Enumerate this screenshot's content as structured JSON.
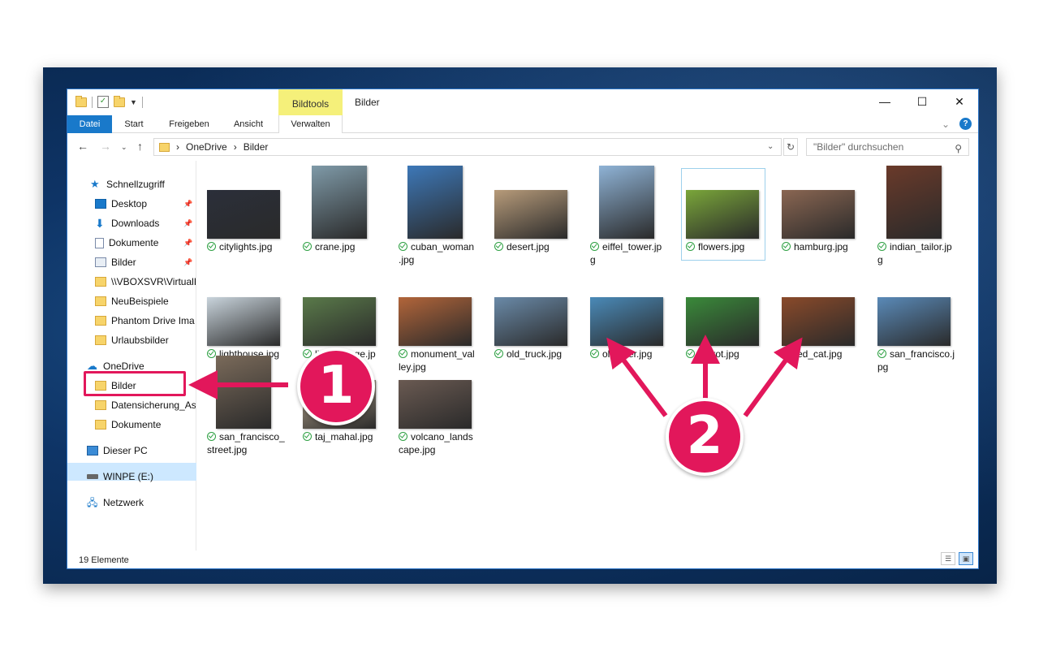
{
  "window": {
    "title": "Bilder",
    "context_tab": "Bildtools",
    "buttons": {
      "minimize": "—",
      "maximize": "☐",
      "close": "✕"
    }
  },
  "ribbon": {
    "tabs": [
      "Datei",
      "Start",
      "Freigeben",
      "Ansicht",
      "Verwalten"
    ]
  },
  "address": {
    "crumbs": [
      "OneDrive",
      "Bilder"
    ],
    "search_placeholder": "\"Bilder\" durchsuchen"
  },
  "nav": {
    "quick_access": "Schnellzugriff",
    "quick_items": [
      "Desktop",
      "Downloads",
      "Dokumente",
      "Bilder",
      "\\\\VBOXSVR\\VirtualB",
      "NeuBeispiele",
      "Phantom Drive Ima",
      "Urlaubsbilder"
    ],
    "onedrive": "OneDrive",
    "onedrive_items": [
      "Bilder",
      "Datensicherung_Ash",
      "Dokumente"
    ],
    "this_pc": "Dieser PC",
    "drive": "WINPE (E:)",
    "network": "Netzwerk"
  },
  "files": [
    {
      "name": "citylights.jpg",
      "color": "#2b2f3a"
    },
    {
      "name": "crane.jpg",
      "color": "#7f9aa8"
    },
    {
      "name": "cuban_woman.jpg",
      "color": "#3d78b8"
    },
    {
      "name": "desert.jpg",
      "color": "#b79b7a"
    },
    {
      "name": "eiffel_tower.jpg",
      "color": "#8fb3d6"
    },
    {
      "name": "flowers.jpg",
      "color": "#7aa63a"
    },
    {
      "name": "hamburg.jpg",
      "color": "#8a6652"
    },
    {
      "name": "indian_tailor.jpg",
      "color": "#6a3a2a"
    },
    {
      "name": "lighthouse.jpg",
      "color": "#c9d4dc"
    },
    {
      "name": "little_village.jpg",
      "color": "#5a7a4a"
    },
    {
      "name": "monument_valley.jpg",
      "color": "#b2653a"
    },
    {
      "name": "old_truck.jpg",
      "color": "#6a8aa8"
    },
    {
      "name": "oldtimer.jpg",
      "color": "#4a8ab8"
    },
    {
      "name": "parrot.jpg",
      "color": "#3a8a3a"
    },
    {
      "name": "red_cat.jpg",
      "color": "#8a4a2a"
    },
    {
      "name": "san_francisco.jpg",
      "color": "#5a8ab8"
    },
    {
      "name": "san_francisco_street.jpg",
      "color": "#7a6a5a"
    },
    {
      "name": "taj_mahal.jpg",
      "color": "#b8a890"
    },
    {
      "name": "volcano_landscape.jpg",
      "color": "#6a5a52"
    }
  ],
  "labels": [
    [
      "citylights.jpg"
    ],
    [
      "crane.jpg"
    ],
    [
      "cuban_woman",
      ".jpg"
    ],
    [
      "desert.jpg"
    ],
    [
      "eiffel_tower.jp",
      "g"
    ],
    [
      "flowers.jpg"
    ],
    [
      "hamburg.jpg"
    ],
    [
      "indian_tailor.jp",
      "g"
    ],
    [
      "lighthouse.jpg"
    ],
    [
      "little_village.jp",
      "g"
    ],
    [
      "monument_val",
      "ley.jpg"
    ],
    [
      "old_truck.jpg"
    ],
    [
      "oldtimer.jpg"
    ],
    [
      "parrot.jpg"
    ],
    [
      "red_cat.jpg"
    ],
    [
      "san_francisco.j",
      "pg"
    ],
    [
      "san_francisco_",
      "street.jpg"
    ],
    [
      "taj_mahal.jpg"
    ],
    [
      "volcano_lands",
      "cape.jpg"
    ]
  ],
  "status": {
    "count": "19 Elemente"
  },
  "annotations": {
    "one": "1",
    "two": "2",
    "accent": "#e2175b"
  }
}
